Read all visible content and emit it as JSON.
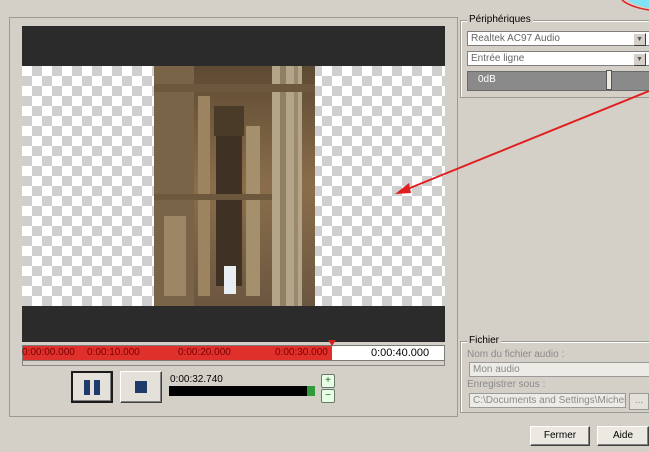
{
  "timeline": {
    "labels_played": [
      "0:00:00.000",
      "0:00:10.000",
      "0:00:20.000",
      "0:00:30.000"
    ],
    "label_after": "0:00:40.000",
    "played_fraction": 0.735
  },
  "transport": {
    "time": "0:00:32.740",
    "level_fraction": 1.0
  },
  "devices": {
    "title": "Périphériques",
    "audio_device": "Realtek AC97 Audio",
    "input": "Entrée ligne",
    "volume_label": "0dB"
  },
  "file": {
    "title": "Fichier",
    "name_label": "Nom du fichier audio :",
    "name_value": "Mon audio",
    "save_label": "Enregistrer sous :",
    "save_value": "C:\\Documents and Settings\\Michel P",
    "browse_label": "..."
  },
  "buttons": {
    "close": "Fermer",
    "help": "Aide"
  },
  "colors": {
    "timeline_played": "#e0302c",
    "annotation_arrow": "#e02020",
    "level_peak": "#2f9b3b"
  }
}
